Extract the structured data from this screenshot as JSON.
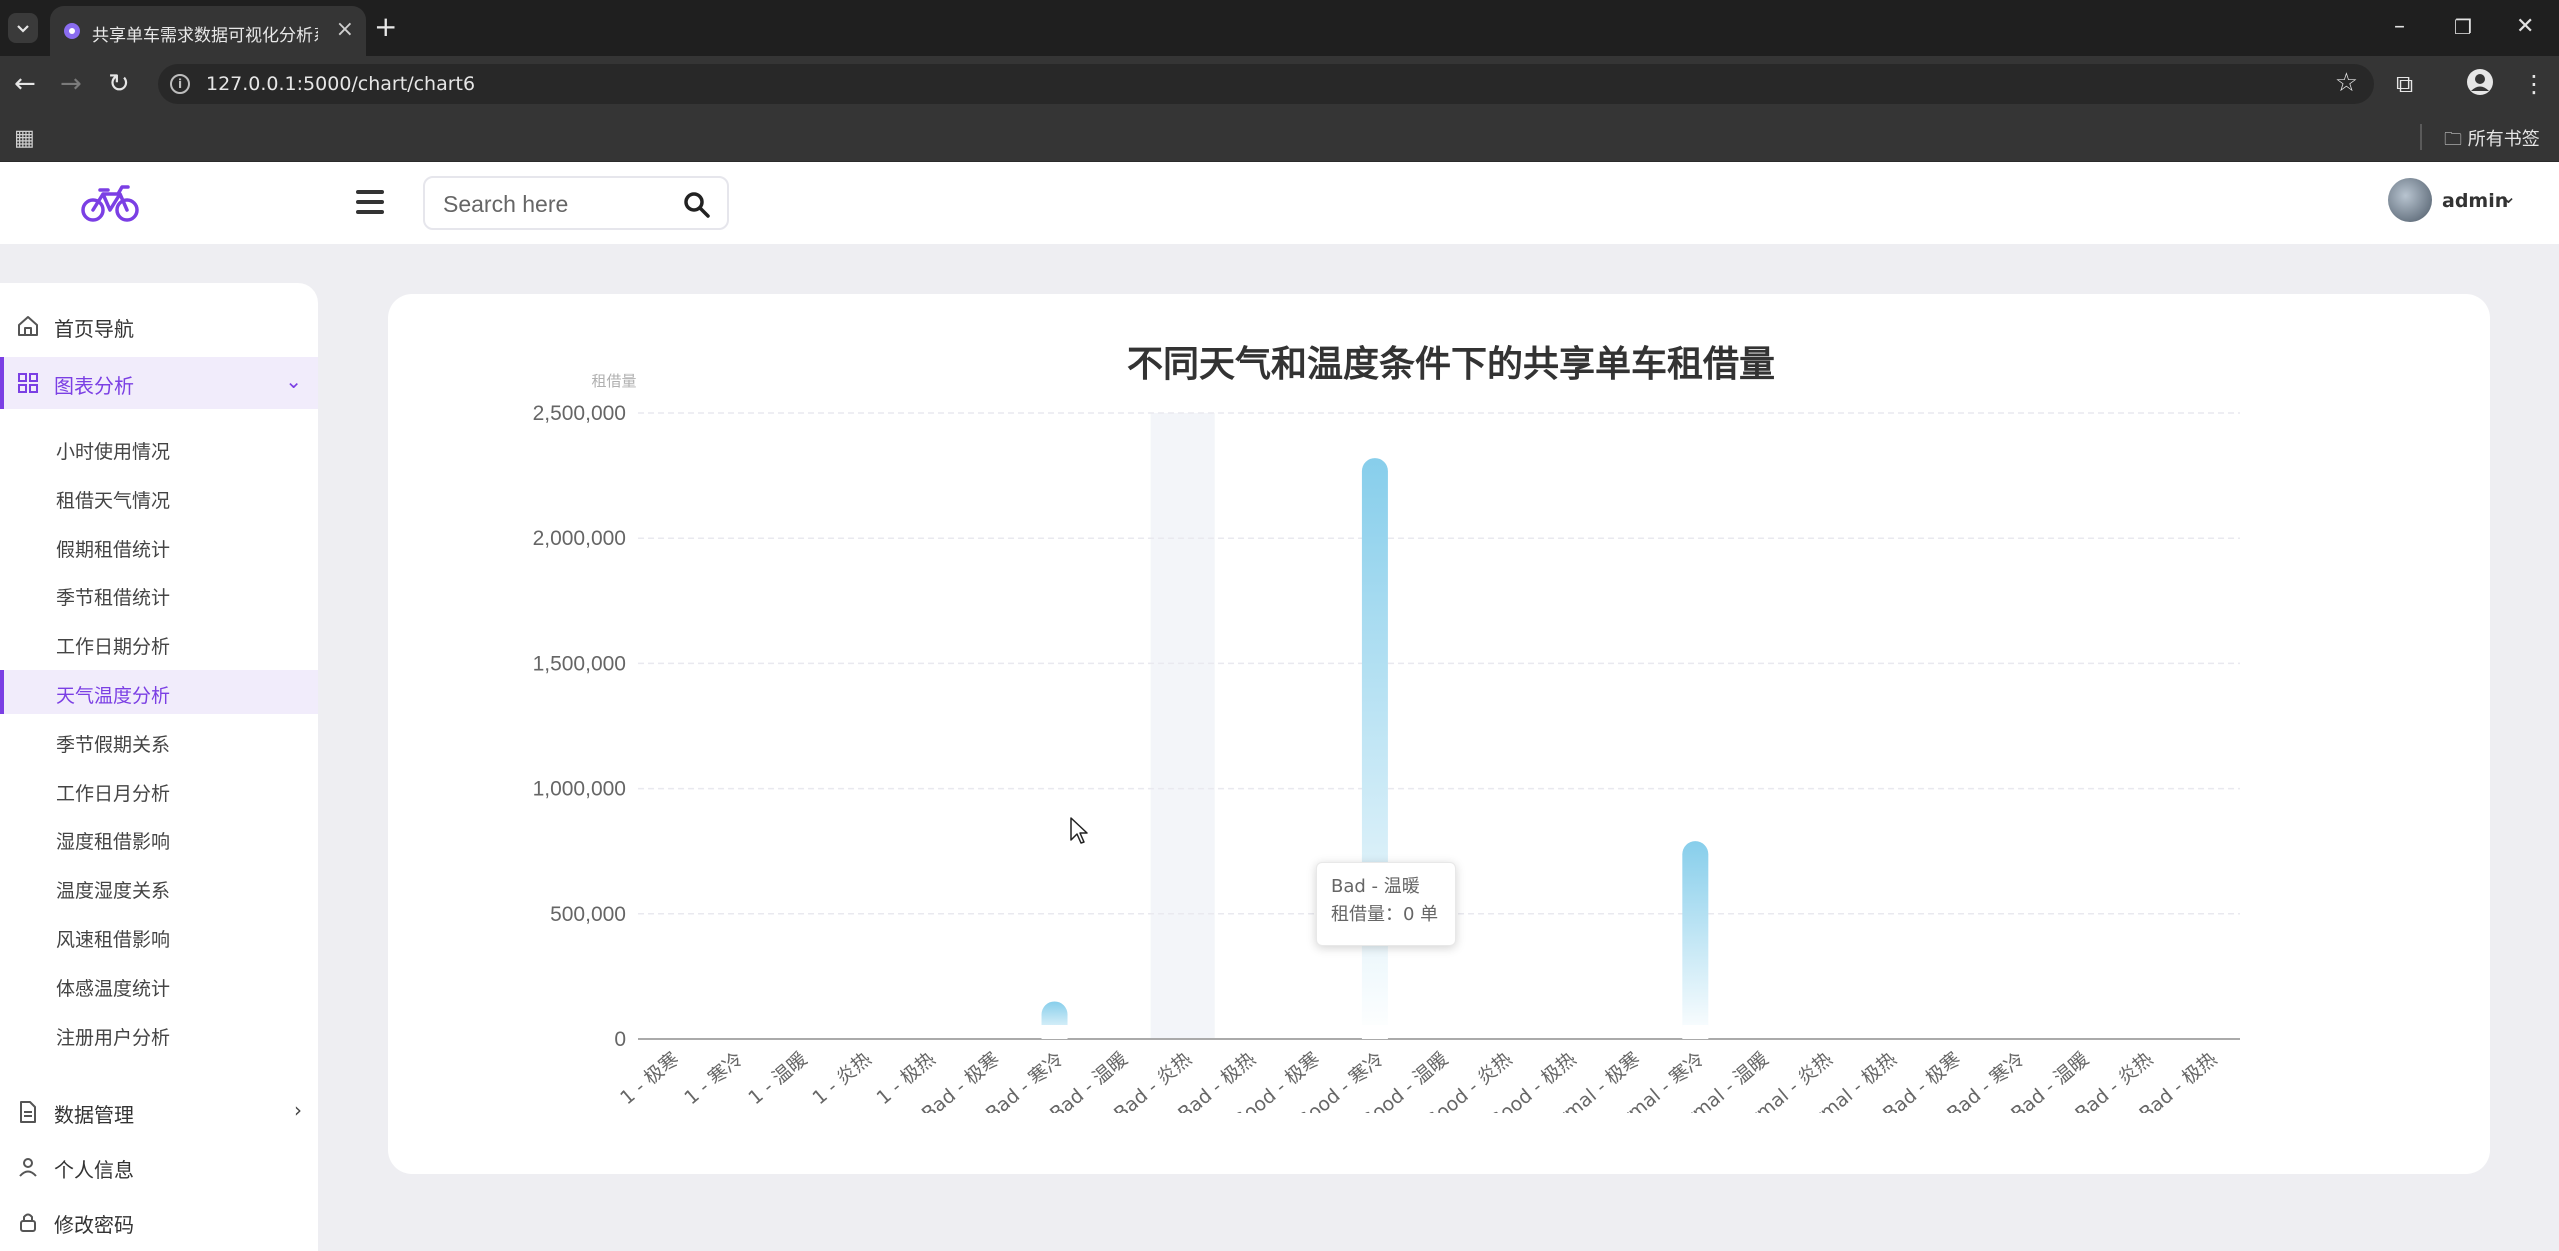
{
  "browser": {
    "tab_title": "共享单车需求数据可视化分析系统",
    "url": "127.0.0.1:5000/chart/chart6",
    "bookmarks_label": "所有书签"
  },
  "header": {
    "search_placeholder": "Search here",
    "user_name": "admin"
  },
  "sidebar": {
    "items": [
      {
        "label": "首页导航",
        "icon": "home-icon"
      },
      {
        "label": "图表分析",
        "icon": "grid-icon"
      },
      {
        "label": "数据管理",
        "icon": "file-icon"
      },
      {
        "label": "个人信息",
        "icon": "user-icon"
      },
      {
        "label": "修改密码",
        "icon": "lock-icon"
      }
    ],
    "sub_items": [
      "小时使用情况",
      "租借天气情况",
      "假期租借统计",
      "季节租借统计",
      "工作日期分析",
      "天气温度分析",
      "季节假期关系",
      "工作日月分析",
      "湿度租借影响",
      "温度湿度关系",
      "风速租借影响",
      "体感温度统计",
      "注册用户分析"
    ],
    "active_sub": "天气温度分析"
  },
  "tooltip": {
    "title": "Bad - 温暖",
    "body": "租借量：0 单"
  },
  "colors": {
    "accent": "#7b3fe4",
    "bar_top": "#87ceeb",
    "bar_bottom": "#ffffff"
  },
  "chart_data": {
    "type": "bar",
    "title": "不同天气和温度条件下的共享单车租借量",
    "ylabel": "租借量",
    "xlabel": "",
    "ylim": [
      0,
      2500000
    ],
    "yticks": [
      "0",
      "500,000",
      "1,000,000",
      "1,500,000",
      "2,000,000",
      "2,500,000"
    ],
    "categories": [
      "1 - 极寒",
      "1 - 寒冷",
      "1 - 温暖",
      "1 - 炎热",
      "1 - 极热",
      "Bad - 极寒",
      "Bad - 寒冷",
      "Bad - 温暖",
      "Bad - 炎热",
      "Bad - 极热",
      "Good - 极寒",
      "Good - 寒冷",
      "Good - 温暖",
      "Good - 炎热",
      "Good - 极热",
      "Normal - 极寒",
      "Normal - 寒冷",
      "Normal - 温暖",
      "Normal - 炎热",
      "Normal - 极热",
      "Very Bad - 极寒",
      "Very Bad - 寒冷",
      "Very Bad - 温暖",
      "Very Bad - 炎热",
      "Very Bad - 极热"
    ],
    "values": [
      0,
      0,
      0,
      0,
      0,
      0,
      150000,
      0,
      0,
      0,
      0,
      2320000,
      0,
      0,
      0,
      0,
      790000,
      0,
      0,
      0,
      0,
      0,
      0,
      0,
      0
    ],
    "highlighted_category": "Bad - 炎热"
  }
}
